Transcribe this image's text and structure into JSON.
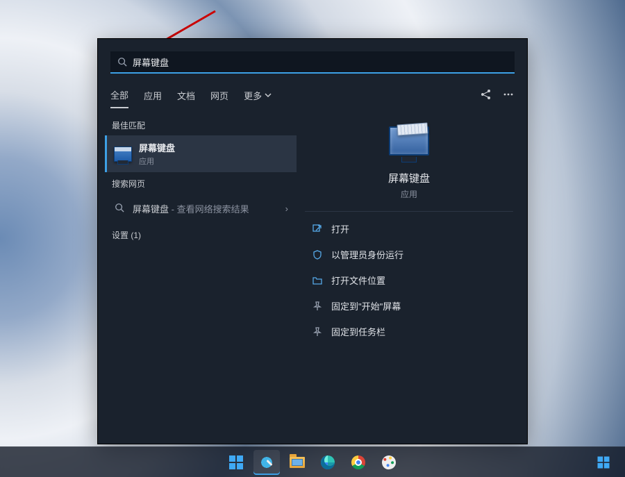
{
  "search": {
    "value": "屏幕键盘"
  },
  "tabs": [
    {
      "label": "全部",
      "active": true
    },
    {
      "label": "应用"
    },
    {
      "label": "文档"
    },
    {
      "label": "网页"
    },
    {
      "label": "更多",
      "more": true
    }
  ],
  "left": {
    "bestMatchHeader": "最佳匹配",
    "bestMatch": {
      "title": "屏幕键盘",
      "subtitle": "应用"
    },
    "webHeader": "搜索网页",
    "webItem": {
      "term": "屏幕键盘",
      "hint": " - 查看网络搜索结果"
    },
    "settingsHeader": "设置 (1)"
  },
  "preview": {
    "title": "屏幕键盘",
    "subtitle": "应用",
    "actions": [
      {
        "icon": "open",
        "label": "打开"
      },
      {
        "icon": "admin",
        "label": "以管理员身份运行"
      },
      {
        "icon": "loc",
        "label": "打开文件位置"
      },
      {
        "icon": "pin",
        "label": "固定到\"开始\"屏幕"
      },
      {
        "icon": "pin",
        "label": "固定到任务栏"
      }
    ]
  },
  "taskbar": {
    "items": [
      "start",
      "search",
      "explorer",
      "edge",
      "chrome",
      "paint"
    ],
    "activeIndex": 1
  }
}
